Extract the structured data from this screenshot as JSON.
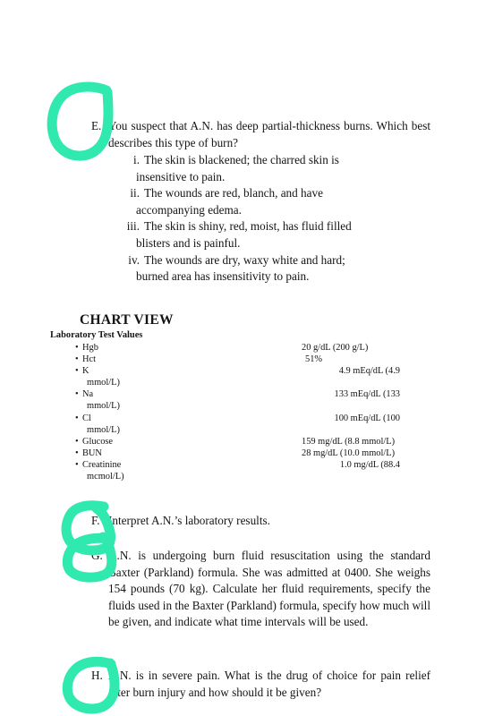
{
  "page": {
    "background_color": "#ffffff",
    "text_color": "#141414"
  },
  "annotation": {
    "ink_color": "#2FE9AE",
    "marks": [
      {
        "name": "circle-around-letter-e",
        "target_letter": "E"
      },
      {
        "name": "double-loop-around-letters-f-and-g",
        "target_letter": "F and G"
      },
      {
        "name": "circle-around-letter-h",
        "target_letter": "H"
      }
    ]
  },
  "questions": {
    "e": {
      "letter": "E.",
      "text": "You suspect that A.N. has deep partial-thickness burns. Which best describes this type of burn?",
      "options": [
        {
          "num": "i.",
          "line1": "The skin is blackened; the charred skin is",
          "line2": "insensitive to pain."
        },
        {
          "num": "ii.",
          "line1": "The wounds are red, blanch, and have",
          "line2": "accompanying edema."
        },
        {
          "num": "iii.",
          "line1": "The skin is shiny, red, moist, has fluid filled",
          "line2": "blisters and is painful."
        },
        {
          "num": "iv.",
          "line1": "The wounds are dry, waxy white and hard;",
          "line2": "burned area has insensitivity to pain."
        }
      ]
    },
    "f": {
      "letter": "F.",
      "text": "Interpret A.N.’s laboratory results."
    },
    "g": {
      "letter": "G.",
      "text": "A.N. is undergoing burn fluid resuscitation using the standard Baxter (Parkland) formula. She was admitted at 0400. She weighs 154 pounds (70 kg). Calculate her fluid requirements, specify the fluids used in the Baxter (Parkland) formula, specify how much will be given, and indicate what time intervals will be used."
    },
    "h": {
      "letter": "H.",
      "text": "A.N. is in severe pain. What is the drug of choice for pain relief after burn injury and how should it be given?"
    }
  },
  "chart_view": {
    "title": "CHART VIEW",
    "subtitle": "Laboratory Test Values",
    "bullet": "•",
    "rows": [
      {
        "name": "Hgb",
        "value": "20 g/dL (200 g/L)",
        "cont": ""
      },
      {
        "name": "Hct",
        "value": "51%",
        "cont": ""
      },
      {
        "name": "K",
        "value": "4.9 mEq/dL (4.9",
        "cont": "mmol/L)"
      },
      {
        "name": "Na",
        "value": "133 mEq/dL (133",
        "cont": "mmol/L)"
      },
      {
        "name": "Cl",
        "value": "100 mEq/dL (100",
        "cont": "mmol/L)"
      },
      {
        "name": "Glucose",
        "value": "159 mg/dL (8.8 mmol/L)",
        "cont": ""
      },
      {
        "name": "BUN",
        "value": "28 mg/dL (10.0 mmol/L)",
        "cont": ""
      },
      {
        "name": "Creatinine",
        "value": "1.0 mg/dL (88.4",
        "cont": "mcmol/L)"
      }
    ]
  }
}
